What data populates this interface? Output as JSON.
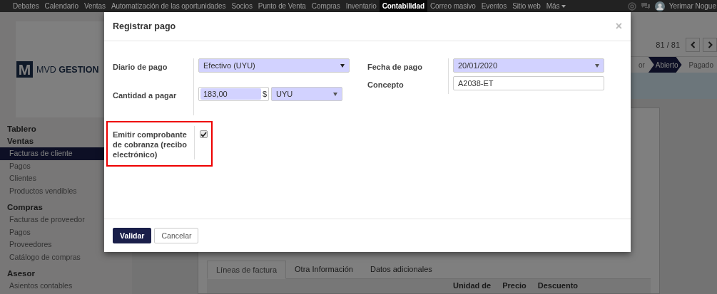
{
  "navbar": {
    "items": [
      {
        "label": "Debates",
        "selected": false
      },
      {
        "label": "Calendario",
        "selected": false
      },
      {
        "label": "Ventas",
        "selected": false
      },
      {
        "label": "Automatización de las oportunidades",
        "selected": false
      },
      {
        "label": "Socios",
        "selected": false
      },
      {
        "label": "Punto de Venta",
        "selected": false
      },
      {
        "label": "Compras",
        "selected": false
      },
      {
        "label": "Inventario",
        "selected": false
      },
      {
        "label": "Contabilidad",
        "selected": true
      },
      {
        "label": "Correo masivo",
        "selected": false
      },
      {
        "label": "Eventos",
        "selected": false
      },
      {
        "label": "Sitio web",
        "selected": false
      },
      {
        "label": "Más",
        "selected": false,
        "dropdown": true
      }
    ],
    "user": "Yerimar Nogue"
  },
  "logo": {
    "mark": "M",
    "text": "MVD **GESTION**"
  },
  "sidebar": {
    "sections": [
      {
        "title": "Tablero"
      },
      {
        "title": "Ventas",
        "items": [
          {
            "label": "Facturas de cliente",
            "selected": true
          },
          {
            "label": "Pagos",
            "selected": false
          },
          {
            "label": "Clientes",
            "selected": false
          },
          {
            "label": "Productos vendibles",
            "selected": false
          }
        ]
      },
      {
        "title": "Compras",
        "items": [
          {
            "label": "Facturas de proveedor",
            "selected": false
          },
          {
            "label": "Pagos",
            "selected": false
          },
          {
            "label": "Proveedores",
            "selected": false
          },
          {
            "label": "Catálogo de compras",
            "selected": false
          }
        ]
      },
      {
        "title": "Asesor",
        "items": [
          {
            "label": "Asientos contables",
            "selected": false
          }
        ]
      }
    ]
  },
  "pager": "81 / 81",
  "status_bar": [
    {
      "label": "or",
      "selected": false
    },
    {
      "label": "Abierto",
      "selected": true
    },
    {
      "label": "Pagado",
      "selected": false
    }
  ],
  "form_tabs": [
    {
      "label": "Líneas de factura",
      "selected": true
    },
    {
      "label": "Otra Información",
      "selected": false
    },
    {
      "label": "Datos adicionales",
      "selected": false
    }
  ],
  "table": {
    "columns": [
      "Unidad de",
      "Precio",
      "Descuento"
    ]
  },
  "dialog": {
    "title": "Registrar pago",
    "close": "×",
    "left_fields": [
      {
        "kind": "select",
        "label": "Diario de pago",
        "value": "Efectivo (UYU)",
        "required": true
      },
      {
        "kind": "amount",
        "label": "Cantidad a pagar",
        "value": "183,00",
        "symbol": "$",
        "currency": "UYU",
        "required": true
      },
      {
        "kind": "checkbox",
        "label": "Emitir comprobante de cobranza (recibo electrónico)",
        "checked": true,
        "highlighted": true
      }
    ],
    "right_fields": [
      {
        "kind": "date",
        "label": "Fecha de pago",
        "value": "20/01/2020",
        "required": true
      },
      {
        "kind": "text",
        "label": "Concepto",
        "value": "A2038-ET",
        "required": false
      }
    ],
    "buttons": [
      {
        "label": "Validar",
        "primary": true
      },
      {
        "label": "Cancelar",
        "primary": false
      }
    ]
  }
}
